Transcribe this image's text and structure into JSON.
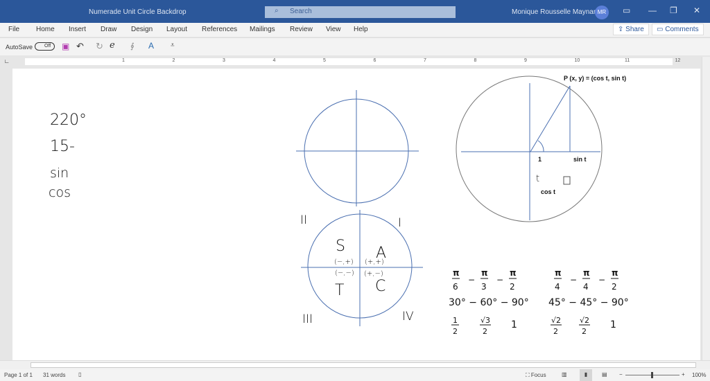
{
  "titlebar": {
    "title": "Numerade Unit Circle Backdrop",
    "search_placeholder": "Search",
    "user": "Monique Rousselle Maynard",
    "initials": "MR"
  },
  "menu": {
    "items": [
      "File",
      "Home",
      "Insert",
      "Draw",
      "Design",
      "Layout",
      "References",
      "Mailings",
      "Review",
      "View",
      "Help"
    ],
    "share": "Share",
    "comments": "Comments"
  },
  "qat": {
    "autosave": "AutoSave",
    "toggle": "Off"
  },
  "ruler": {
    "labels": [
      "1",
      "2",
      "3",
      "4",
      "5",
      "6",
      "7",
      "8",
      "9",
      "10",
      "11",
      "12"
    ]
  },
  "notes": {
    "line1": "220°",
    "line2": "15-",
    "line3": "sin",
    "line4": "cos"
  },
  "quadrants": {
    "q1": "I",
    "q2": "II",
    "q3": "III",
    "q4": "IV",
    "s": "S",
    "a": "A",
    "t": "T",
    "c": "C",
    "signs_q2": "(−,+)",
    "signs_q1": "(+,+)",
    "signs_q3": "(−,−)",
    "signs_q4": "(+,−)"
  },
  "unit_circle": {
    "point_label": "P (x, y) = (cos t, sin t)",
    "one": "1",
    "sin": "sin t",
    "t": "t",
    "cos": "cos t"
  },
  "triangles": {
    "t1": {
      "fractions": [
        [
          "π",
          "6"
        ],
        [
          "π",
          "3"
        ],
        [
          "π",
          "2"
        ]
      ],
      "degrees": "30° − 60° − 90°",
      "ratios": [
        [
          "1",
          "2"
        ],
        [
          "√3",
          "2"
        ],
        "1"
      ]
    },
    "t2": {
      "fractions": [
        [
          "π",
          "4"
        ],
        [
          "π",
          "4"
        ],
        [
          "π",
          "2"
        ]
      ],
      "degrees": "45° − 45° − 90°",
      "ratios": [
        [
          "√2",
          "2"
        ],
        [
          "√2",
          "2"
        ],
        "1"
      ]
    },
    "dash": "−"
  },
  "status": {
    "page": "Page 1 of 1",
    "words": "31 words",
    "focus": "Focus",
    "zoom": "100%"
  },
  "colors": {
    "titlebar": "#2b579a",
    "axis": "#4a6fb0"
  }
}
